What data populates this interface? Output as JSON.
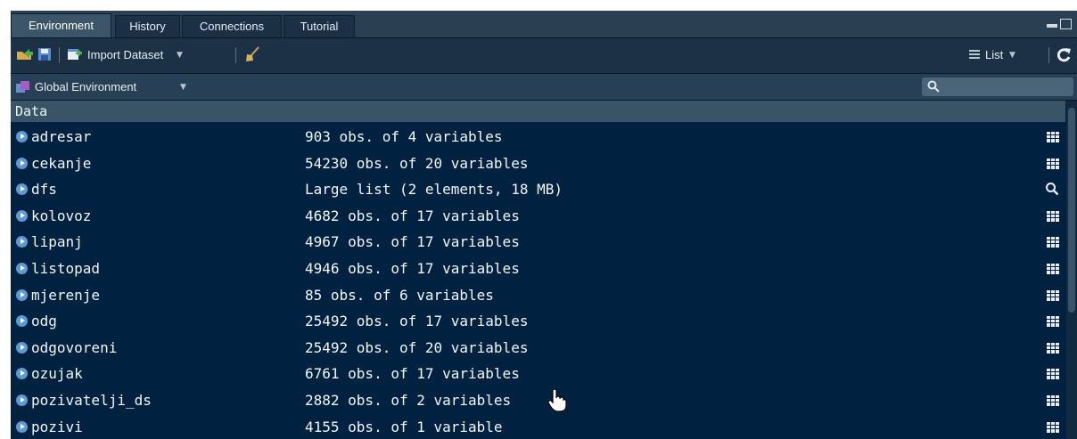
{
  "tabs": [
    {
      "label": "Environment",
      "active": true
    },
    {
      "label": "History",
      "active": false
    },
    {
      "label": "Connections",
      "active": false
    },
    {
      "label": "Tutorial",
      "active": false
    }
  ],
  "toolbar": {
    "import_label": "Import Dataset",
    "view_mode": "List"
  },
  "envbar": {
    "scope": "Global Environment"
  },
  "section_header": "Data",
  "rows": [
    {
      "name": "adresar",
      "desc": "903 obs. of 4 variables",
      "icon": "table-icon"
    },
    {
      "name": "cekanje",
      "desc": "54230 obs. of 20 variables",
      "icon": "table-icon"
    },
    {
      "name": "dfs",
      "desc": "Large list (2 elements, 18 MB)",
      "icon": "search-icon"
    },
    {
      "name": "kolovoz",
      "desc": "4682 obs. of 17 variables",
      "icon": "table-icon"
    },
    {
      "name": "lipanj",
      "desc": "4967 obs. of 17 variables",
      "icon": "table-icon"
    },
    {
      "name": "listopad",
      "desc": "4946 obs. of 17 variables",
      "icon": "table-icon"
    },
    {
      "name": "mjerenje",
      "desc": "85 obs. of 6 variables",
      "icon": "table-icon"
    },
    {
      "name": "odg",
      "desc": "25492 obs. of 17 variables",
      "icon": "table-icon"
    },
    {
      "name": "odgovoreni",
      "desc": "25492 obs. of 20 variables",
      "icon": "table-icon"
    },
    {
      "name": "ozujak",
      "desc": "6761 obs. of 17 variables",
      "icon": "table-icon"
    },
    {
      "name": "pozivatelji_ds",
      "desc": "2882 obs. of 2 variables",
      "icon": "table-icon"
    },
    {
      "name": "pozivi",
      "desc": "4155 obs. of 1 variable",
      "icon": "table-icon"
    }
  ]
}
